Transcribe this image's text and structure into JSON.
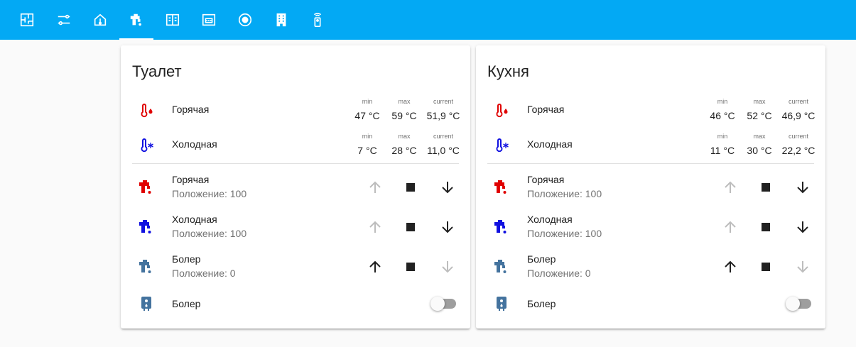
{
  "colors": {
    "topbar": "#03a9f4",
    "hot": "#e00000",
    "cold": "#1010e0",
    "boiler": "#44739e",
    "disabled": "#bdbdbd"
  },
  "tabs": [
    {
      "icon": "floorplan-icon"
    },
    {
      "icon": "tune-icon"
    },
    {
      "icon": "home-thermometer-icon"
    },
    {
      "icon": "water-tap-icon",
      "active": true
    },
    {
      "icon": "power-panel-icon"
    },
    {
      "icon": "network-switch-icon"
    },
    {
      "icon": "robot-vacuum-icon"
    },
    {
      "icon": "office-building-icon"
    },
    {
      "icon": "remote-icon"
    }
  ],
  "cards": [
    {
      "title": "Туалет",
      "sensors": [
        {
          "name": "Горячая",
          "icon": "thermometer-hot-icon",
          "stats": [
            {
              "label": "min",
              "value": "47 °C"
            },
            {
              "label": "max",
              "value": "59 °C"
            },
            {
              "label": "current",
              "value": "51,9 °C"
            }
          ]
        },
        {
          "name": "Холодная",
          "icon": "thermometer-cold-icon",
          "stats": [
            {
              "label": "min",
              "value": "7 °C"
            },
            {
              "label": "max",
              "value": "28 °C"
            },
            {
              "label": "current",
              "value": "11,0 °C"
            }
          ]
        }
      ],
      "valves": [
        {
          "name": "Горячая",
          "position": "Положение: 100",
          "icon": "water-valve-hot-icon",
          "up_enabled": false,
          "down_enabled": true
        },
        {
          "name": "Холодная",
          "position": "Положение: 100",
          "icon": "water-valve-cold-icon",
          "up_enabled": false,
          "down_enabled": true
        },
        {
          "name": "Болер",
          "position": "Положение: 0",
          "icon": "water-valve-boiler-icon",
          "up_enabled": true,
          "down_enabled": false
        }
      ],
      "switch": {
        "name": "Болер",
        "icon": "water-boiler-icon",
        "on": false
      }
    },
    {
      "title": "Кухня",
      "sensors": [
        {
          "name": "Горячая",
          "icon": "thermometer-hot-icon",
          "stats": [
            {
              "label": "min",
              "value": "46 °C"
            },
            {
              "label": "max",
              "value": "52 °C"
            },
            {
              "label": "current",
              "value": "46,9 °C"
            }
          ]
        },
        {
          "name": "Холодная",
          "icon": "thermometer-cold-icon",
          "stats": [
            {
              "label": "min",
              "value": "11 °C"
            },
            {
              "label": "max",
              "value": "30 °C"
            },
            {
              "label": "current",
              "value": "22,2 °C"
            }
          ]
        }
      ],
      "valves": [
        {
          "name": "Горячая",
          "position": "Положение: 100",
          "icon": "water-valve-hot-icon",
          "up_enabled": false,
          "down_enabled": true
        },
        {
          "name": "Холодная",
          "position": "Положение: 100",
          "icon": "water-valve-cold-icon",
          "up_enabled": false,
          "down_enabled": true
        },
        {
          "name": "Болер",
          "position": "Положение: 0",
          "icon": "water-valve-boiler-icon",
          "up_enabled": true,
          "down_enabled": false
        }
      ],
      "switch": {
        "name": "Болер",
        "icon": "water-boiler-icon",
        "on": false
      }
    }
  ]
}
